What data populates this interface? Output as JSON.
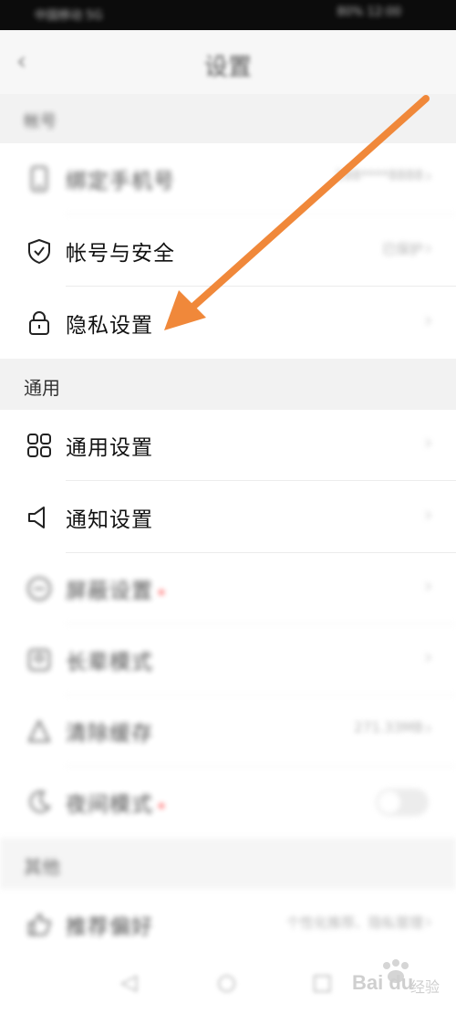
{
  "status_bar": {
    "left": "中国移动 5G",
    "right": "80%  12:00"
  },
  "header": {
    "back_icon": "back-icon",
    "title": "设置"
  },
  "sections": {
    "account": "帐号",
    "general": "通用",
    "other": "其他"
  },
  "rows": {
    "bind_phone": {
      "label": "绑定手机号",
      "value": "188****8888"
    },
    "account_security": {
      "label": "帐号与安全",
      "value": "已保护"
    },
    "privacy": {
      "label": "隐私设置"
    },
    "general_settings": {
      "label": "通用设置"
    },
    "notification_settings": {
      "label": "通知设置"
    },
    "block_settings": {
      "label": "屏蔽设置"
    },
    "elder_mode": {
      "label": "长辈模式"
    },
    "clear_cache": {
      "label": "清除缓存",
      "value": "271.33MB"
    },
    "theme_mode": {
      "label": "夜间模式",
      "toggle_on": false
    },
    "recommend": {
      "label": "推荐偏好",
      "value": "个性化推荐、隐私管理"
    }
  },
  "watermark": {
    "main": "Bai du",
    "sub": "经验"
  },
  "colors": {
    "arrow": "#f0883a",
    "red_dot": "#f44444",
    "section_bg": "#f2f2f2"
  },
  "icons": {
    "phone": "phone-icon",
    "shield": "shield-icon",
    "lock": "lock-icon",
    "grid": "grid-icon",
    "speaker": "speaker-icon",
    "block": "block-icon"
  }
}
